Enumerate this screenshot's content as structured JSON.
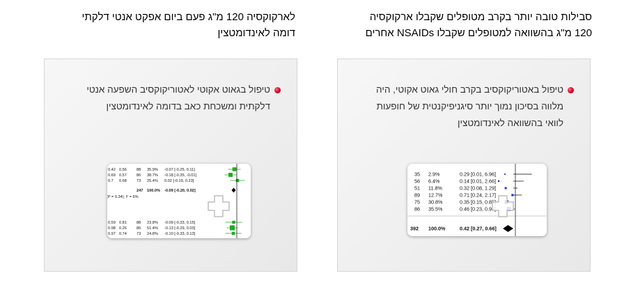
{
  "right_column": {
    "heading_lines": [
      "סבילות טובה יותר בקרב מטופלים שקבלו ארקוקסיה",
      "120 מ\"ג בהשוואה למטופלים שקבלו NSAIDs אחרים"
    ],
    "bullet_lines": [
      "טיפול באטוריקוקסיב בקרב חולי גאוט אקוטי, היה",
      "מלווה בסיכון נמוך יותר סיגניפיקנטית של חופעות",
      "לוואי בהשוואה לאינדומטצין"
    ],
    "forest_rows": [
      {
        "n": "35",
        "pct": "2.9%",
        "ci": "0.29 [0.01, 6.96]",
        "est": 0.29,
        "lo": 0.01,
        "hi": 6.96
      },
      {
        "n": "56",
        "pct": "6.4%",
        "ci": "0.14 [0.01, 2.66]",
        "est": 0.14,
        "lo": 0.01,
        "hi": 2.66
      },
      {
        "n": "51",
        "pct": "11.8%",
        "ci": "0.32 [0.08, 1.29]",
        "est": 0.32,
        "lo": 0.08,
        "hi": 1.29
      },
      {
        "n": "89",
        "pct": "12.7%",
        "ci": "0.71 [0.24, 2.17]",
        "est": 0.71,
        "lo": 0.24,
        "hi": 2.17
      },
      {
        "n": "75",
        "pct": "30.8%",
        "ci": "0.35 [0.15, 0.85]",
        "est": 0.35,
        "lo": 0.15,
        "hi": 0.85
      },
      {
        "n": "86",
        "pct": "35.5%",
        "ci": "0.46 [0.23, 0.95]",
        "est": 0.46,
        "lo": 0.23,
        "hi": 0.95
      }
    ],
    "forest_total": {
      "n": "392",
      "pct": "100.0%",
      "ci": "0.42 [0.27, 0.66]",
      "est": 0.42,
      "lo": 0.27,
      "hi": 0.66
    }
  },
  "left_column": {
    "heading_lines": [
      "לארקוקסיה 120 מ\"ג פעם ביום אפקט אנטי דלקתי",
      "דומה לאינדומטצין"
    ],
    "bullet_lines": [
      "טיפול בגאוט אקוטי לאטוריקוקסיב השפעה אנטי",
      "דלקתית ומשכחת כאב בדומה לאינדומטצין"
    ],
    "forest_rows_top": [
      {
        "a": "0.42",
        "b": "0.56",
        "n": "88",
        "pct": "35.9%",
        "ci": "-0.07 [-0.25, 0.11]",
        "est": -0.07,
        "lo": -0.25,
        "hi": 0.11
      },
      {
        "a": "0.69",
        "b": "0.57",
        "n": "86",
        "pct": "38.7%",
        "ci": "-0.18 [-0.35, -0.01]",
        "est": -0.18,
        "lo": -0.35,
        "hi": -0.01
      },
      {
        "a": "0.7",
        "b": "0.68",
        "n": "73",
        "pct": "25.4%",
        "ci": "0.02 [-0.19, 0.23]",
        "est": 0.02,
        "lo": -0.19,
        "hi": 0.23
      }
    ],
    "forest_total": {
      "n": "247",
      "pct": "100.0%",
      "ci": "-0.09 [-0.20, 0.02]",
      "est": -0.09,
      "lo": -0.2,
      "hi": 0.02
    },
    "heterogeneity": "(P = 0.34); I² = 6%",
    "forest_rows_bottom": [
      {
        "a": "0.59",
        "b": "0.81",
        "n": "88",
        "pct": "23.8%",
        "ci": "-0.09 [-0.33, 0.15]",
        "est": -0.09,
        "lo": -0.33,
        "hi": 0.15
      },
      {
        "a": "0.98",
        "b": "0.26",
        "n": "86",
        "pct": "51.4%",
        "ci": "-0.13 [-0.29, 0.03]",
        "est": -0.13,
        "lo": -0.29,
        "hi": 0.03
      },
      {
        "a": "0.97",
        "b": "0.74",
        "n": "73",
        "pct": "24.8%",
        "ci": "-0.10 [-0.33, 0.13]",
        "est": -0.1,
        "lo": -0.33,
        "hi": 0.13
      }
    ]
  },
  "colors": {
    "bullet": "#d4002a",
    "left_marker": "#22aa22",
    "right_marker": "#1f2fd0"
  },
  "icons": {
    "zoom": "magnifier-plus-icon"
  }
}
